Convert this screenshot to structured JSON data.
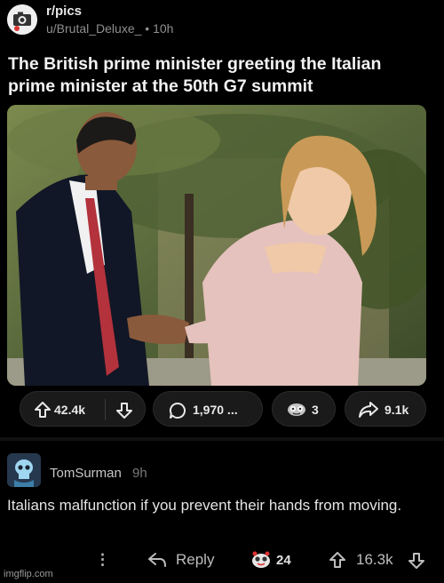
{
  "post": {
    "subreddit": "r/pics",
    "author": "u/Brutal_Deluxe_",
    "age": "10h",
    "title": "The British prime minister greeting the Italian prime minister at the 50th G7 summit"
  },
  "actions": {
    "upvotes": "42.4k",
    "comments": "1,970 ...",
    "awards": "3",
    "shares": "9.1k"
  },
  "comment": {
    "user": "TomSurman",
    "age": "9h",
    "body": "Italians malfunction if you prevent their hands from moving.",
    "reply_label": "Reply",
    "awards": "24",
    "upvotes": "16.3k",
    "more_glyph": "⋮"
  },
  "watermark": "imgflip.com",
  "icons": {
    "upvote": "arrow-up-icon",
    "downvote": "arrow-down-icon",
    "comment": "speech-bubble-icon",
    "award": "award-icon",
    "share": "share-arrow-icon",
    "reply": "reply-arrow-icon",
    "more": "more-vertical-icon"
  },
  "colors": {
    "background": "#000000",
    "pill": "#1a1a1b",
    "text": "#e8e8e8",
    "muted": "#8e8e8e"
  }
}
